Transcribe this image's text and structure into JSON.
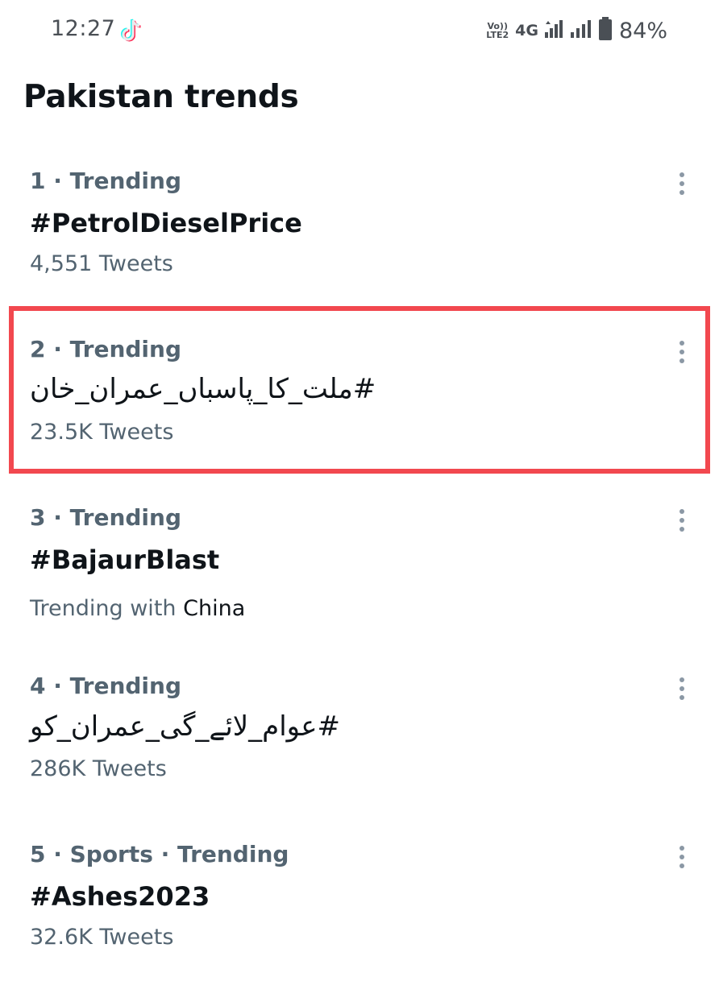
{
  "status_bar": {
    "time": "12:27",
    "volte_top": "Vo))",
    "volte_bottom": "LTE2",
    "network": "4G",
    "battery": "84%"
  },
  "page": {
    "title": "Pakistan trends"
  },
  "trends": [
    {
      "meta": "1 · Trending",
      "name": "#PetrolDieselPrice",
      "sub": "4,551 Tweets"
    },
    {
      "meta": "2 · Trending",
      "name": "#ملت_کا_پاسباں_عمران_خان",
      "sub": "23.5K Tweets"
    },
    {
      "meta": "3 · Trending",
      "name": "#BajaurBlast",
      "sub_prefix": "Trending with ",
      "sub_topic": "China"
    },
    {
      "meta": "4 · Trending",
      "name": "#عوام_لائے_گی_عمران_کو",
      "sub": "286K Tweets"
    },
    {
      "meta": "5 · Sports · Trending",
      "name": "#Ashes2023",
      "sub": "32.6K Tweets"
    }
  ],
  "colors": {
    "highlight": "#f2484f",
    "secondary_text": "#536471",
    "primary_text": "#0f1419"
  }
}
